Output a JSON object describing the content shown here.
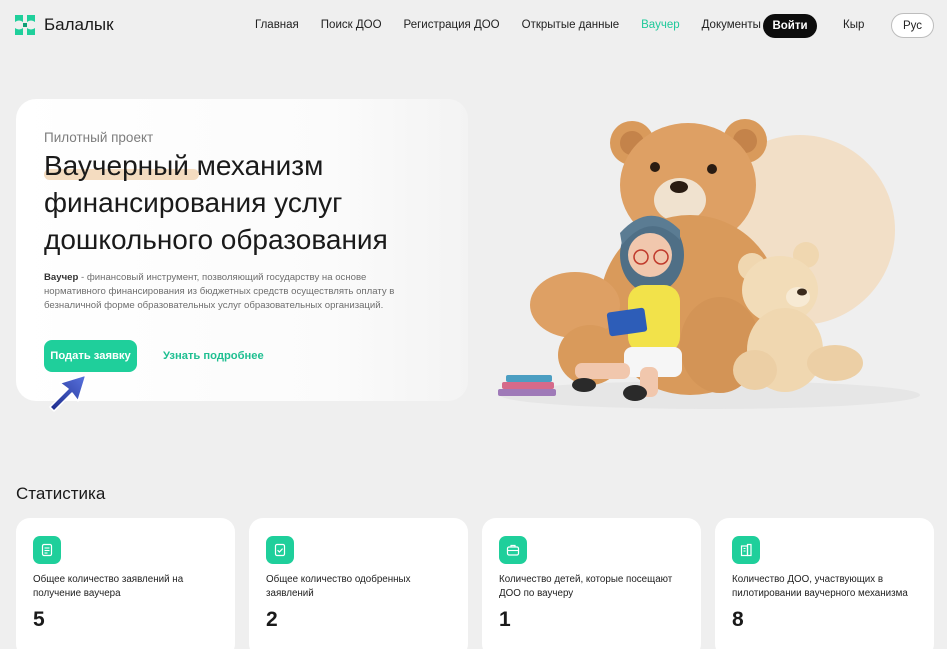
{
  "header": {
    "logo_text": "Балалык",
    "nav": [
      {
        "label": "Главная"
      },
      {
        "label": "Поиск ДОО"
      },
      {
        "label": "Регистрация ДОО"
      },
      {
        "label": "Открытые данные"
      },
      {
        "label": "Ваучер",
        "active": true
      },
      {
        "label": "Документы"
      }
    ],
    "login_label": "Войти",
    "lang_kg": "Кыр",
    "lang_ru": "Рус"
  },
  "hero": {
    "kicker": "Пилотный проект",
    "title_highlight": "Ваучерный",
    "title_rest": " механизм финансирования услуг дошкольного образования",
    "desc_term": "Ваучер",
    "desc_text": " - финансовый инструмент, позволяющий государству на основе нормативного финансирования из бюджетных средств осуществлять оплату в безналичной форме образовательных услуг образовательных организаций.",
    "apply_label": "Подать заявку",
    "more_label": "Узнать подробнее"
  },
  "stats": {
    "title": "Статистика",
    "cards": [
      {
        "icon": "document-icon",
        "label": "Общее количество заявлений на получение ваучера",
        "value": "5"
      },
      {
        "icon": "check-document-icon",
        "label": "Общее количество одобренных заявлений",
        "value": "2"
      },
      {
        "icon": "briefcase-icon",
        "label": "Количество детей, которые посещают ДОО по ваучеру",
        "value": "1"
      },
      {
        "icon": "building-icon",
        "label": "Количество ДОО, участвующих в пилотировании ваучерного механизма",
        "value": "8"
      }
    ]
  },
  "colors": {
    "accent": "#1fcf9b",
    "active_nav": "#1ec99a",
    "highlight": "#f4dcc0",
    "background": "#efefef"
  }
}
